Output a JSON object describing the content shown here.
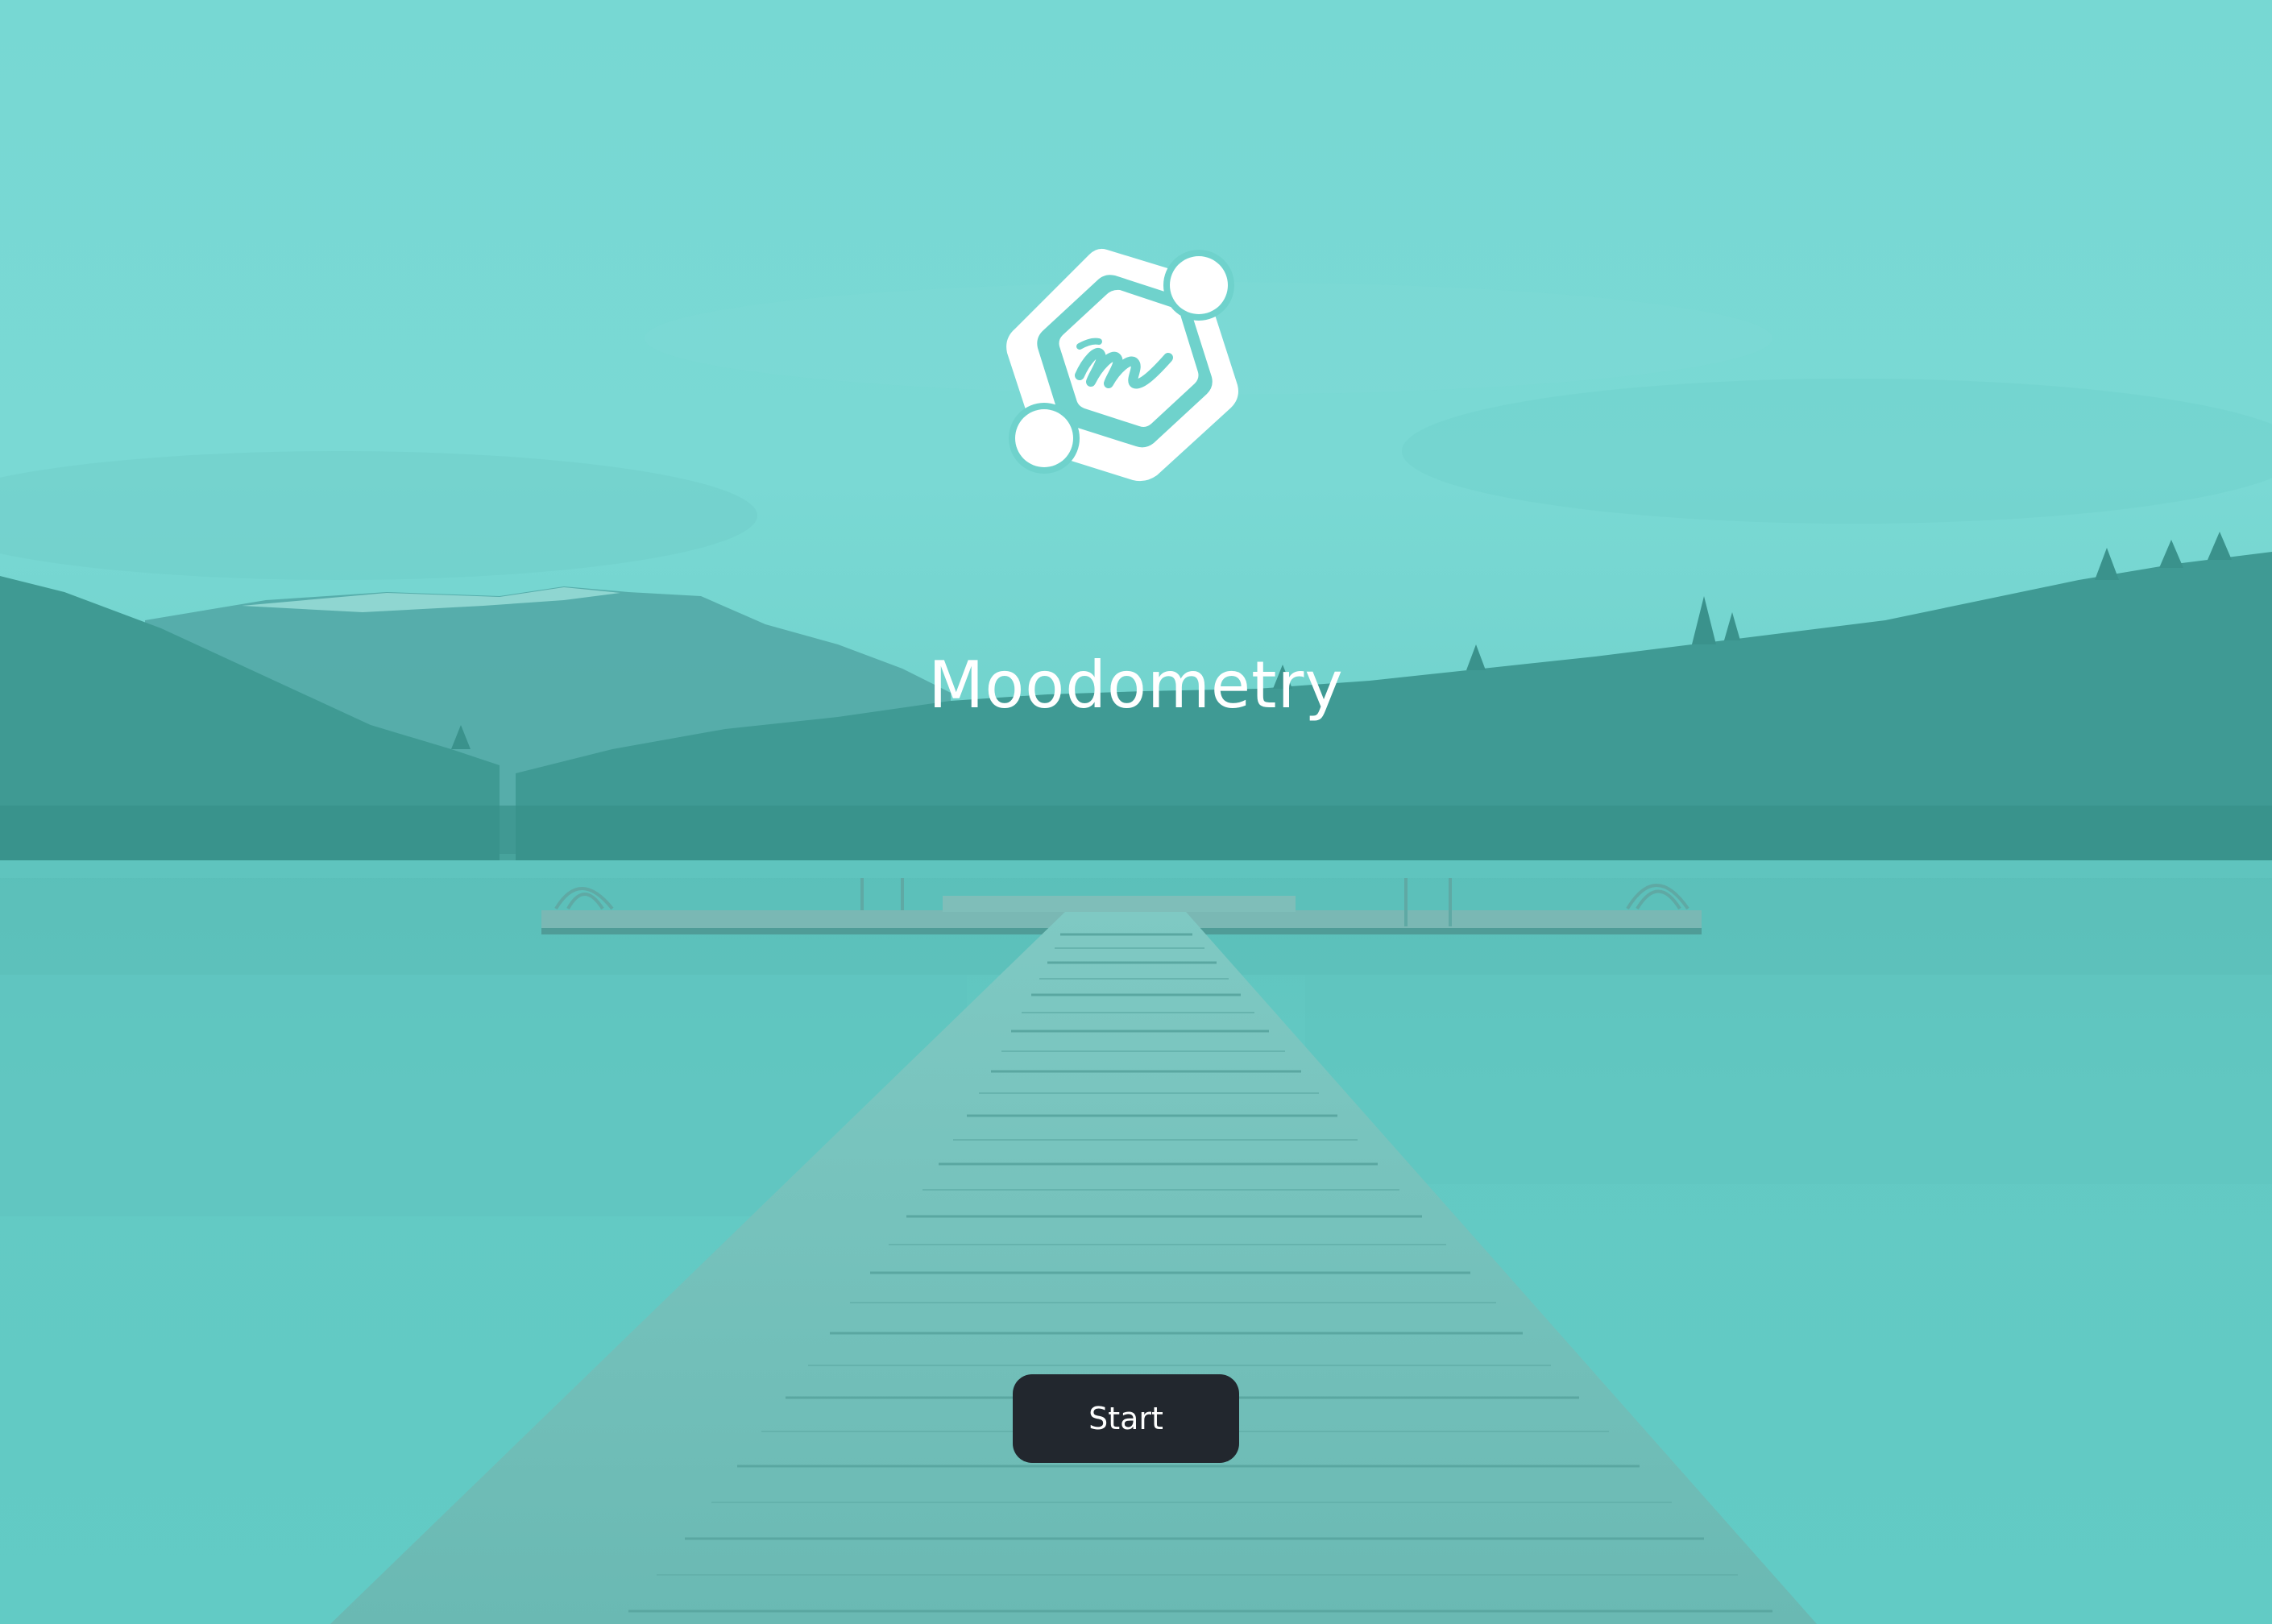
{
  "app": {
    "title": "Moodometry",
    "logo_icon": "moodometry-logo-icon",
    "logo_letter": "m"
  },
  "actions": {
    "start_label": "Start"
  },
  "background": {
    "scene": "lake-dock-icon",
    "tint": "#6fd2cc"
  },
  "colors": {
    "teal_tint": "#6fd2cc",
    "button_bg": "#22272e",
    "button_text": "#ffffff",
    "title_text": "#ffffff"
  }
}
